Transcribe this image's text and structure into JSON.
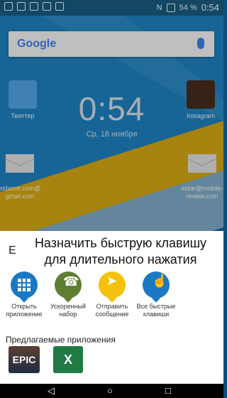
{
  "status_bar": {
    "battery": "54 %",
    "time": "0:54"
  },
  "search": {
    "logo": "Google"
  },
  "home": {
    "clock": "0:54",
    "date": "Ср, 18 ноября",
    "apps": [
      {
        "label": "Твиттер"
      },
      {
        "label": "Instagram"
      },
      {
        "label": "eldarmr.com@\ngmail.com"
      },
      {
        "label": "eldar@mobile-\nreview.com"
      }
    ]
  },
  "sheet": {
    "letter": "E",
    "title": "Назначить быструю клавишу для длительного нажатия",
    "actions": [
      {
        "label": "Открыть приложение"
      },
      {
        "label": "Ускоренный набор"
      },
      {
        "label": "Отправить сообщение"
      },
      {
        "label": "Все быстрые клавиши"
      }
    ],
    "suggested_title": "Предлагаемые приложения",
    "suggested_apps": [
      {
        "label": "EPIC"
      },
      {
        "label": "X"
      }
    ]
  },
  "colors": {
    "wall": "#1f87c8",
    "sheet": "#ffffff",
    "accent_blue": "#1b78c3",
    "green": "#5f7e34",
    "yellow": "#f4c20d"
  }
}
